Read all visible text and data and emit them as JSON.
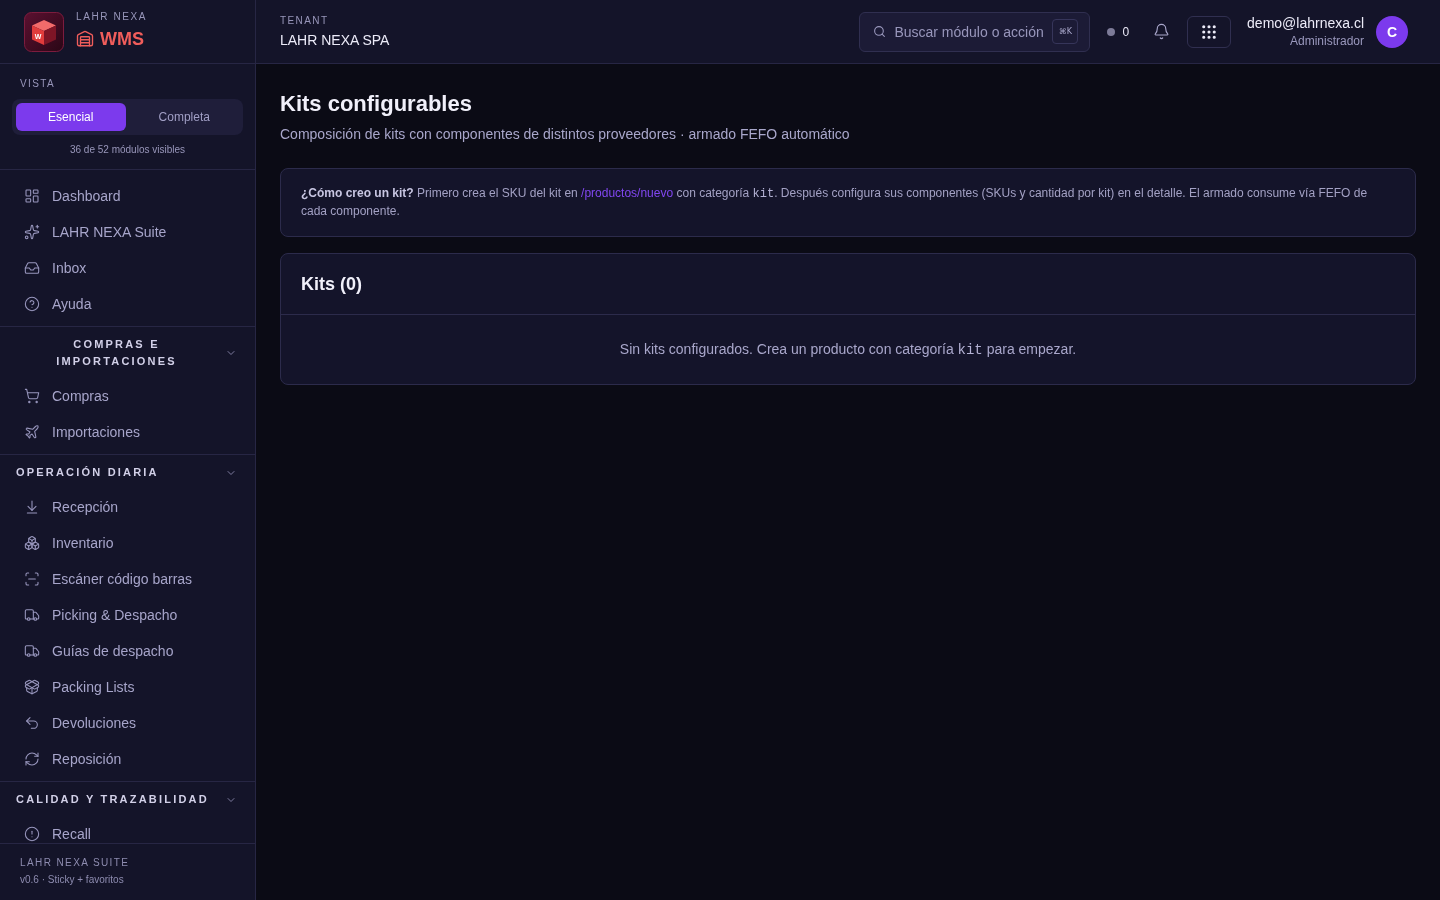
{
  "sidebar": {
    "brand": {
      "overline": "LAHR NEXA",
      "logo_letter": "W",
      "product": "WMS"
    },
    "view": {
      "label": "VISTA",
      "options": [
        {
          "label": "Esencial",
          "selected": true
        },
        {
          "label": "Completa",
          "selected": false
        }
      ],
      "note": "36 de 52 módulos visibles"
    },
    "items": [
      "Dashboard",
      "LAHR NEXA Suite",
      "Inbox",
      "Ayuda"
    ],
    "groups": [
      {
        "title": "COMPRAS E IMPORTACIONES",
        "expanded": true,
        "items": [
          "Compras",
          "Importaciones"
        ]
      },
      {
        "title": "OPERACIÓN DIARIA",
        "expanded": true,
        "items": [
          "Recepción",
          "Inventario",
          "Escáner código barras",
          "Picking & Despacho",
          "Guías de despacho",
          "Packing Lists",
          "Devoluciones",
          "Reposición"
        ]
      },
      {
        "title": "CALIDAD Y TRAZABILIDAD",
        "expanded": true,
        "items": [
          "Recall"
        ]
      }
    ],
    "footer": {
      "title": "LAHR NEXA SUITE",
      "version": "v0.6 · Sticky + favoritos"
    }
  },
  "header": {
    "tenant_label": "TENANT",
    "tenant": "LAHR NEXA SPA",
    "search": {
      "placeholder": "Buscar módulo o acción",
      "shortcut": "⌘K"
    },
    "status_count": "0",
    "user": {
      "email": "demo@lahrnexa.cl",
      "role": "Administrador",
      "initial": "C"
    }
  },
  "page": {
    "title": "Kits configurables",
    "subtitle": "Composición de kits con componentes de distintos proveedores · armado FEFO automático",
    "info": [
      {
        "kind": "text",
        "text": "**¿Cómo creo un kit?** Primero crea el SKU del kit en "
      },
      {
        "kind": "link",
        "text": "/productos/nuevo"
      },
      {
        "kind": "text",
        "text": " con categoría "
      },
      {
        "kind": "code",
        "text": "kit"
      },
      {
        "kind": "text",
        "text": ". Después configura sus componentes (SKUs y cantidad por kit) en el detalle. El armado consume vía FEFO de cada componente."
      }
    ],
    "kits_card": {
      "title": "Kits (0)",
      "empty": [
        {
          "kind": "text",
          "text": "Sin kits configurados. Crea un producto con categoría "
        },
        {
          "kind": "code",
          "text": "kit"
        },
        {
          "kind": "text",
          "text": " para empezar."
        }
      ]
    }
  }
}
